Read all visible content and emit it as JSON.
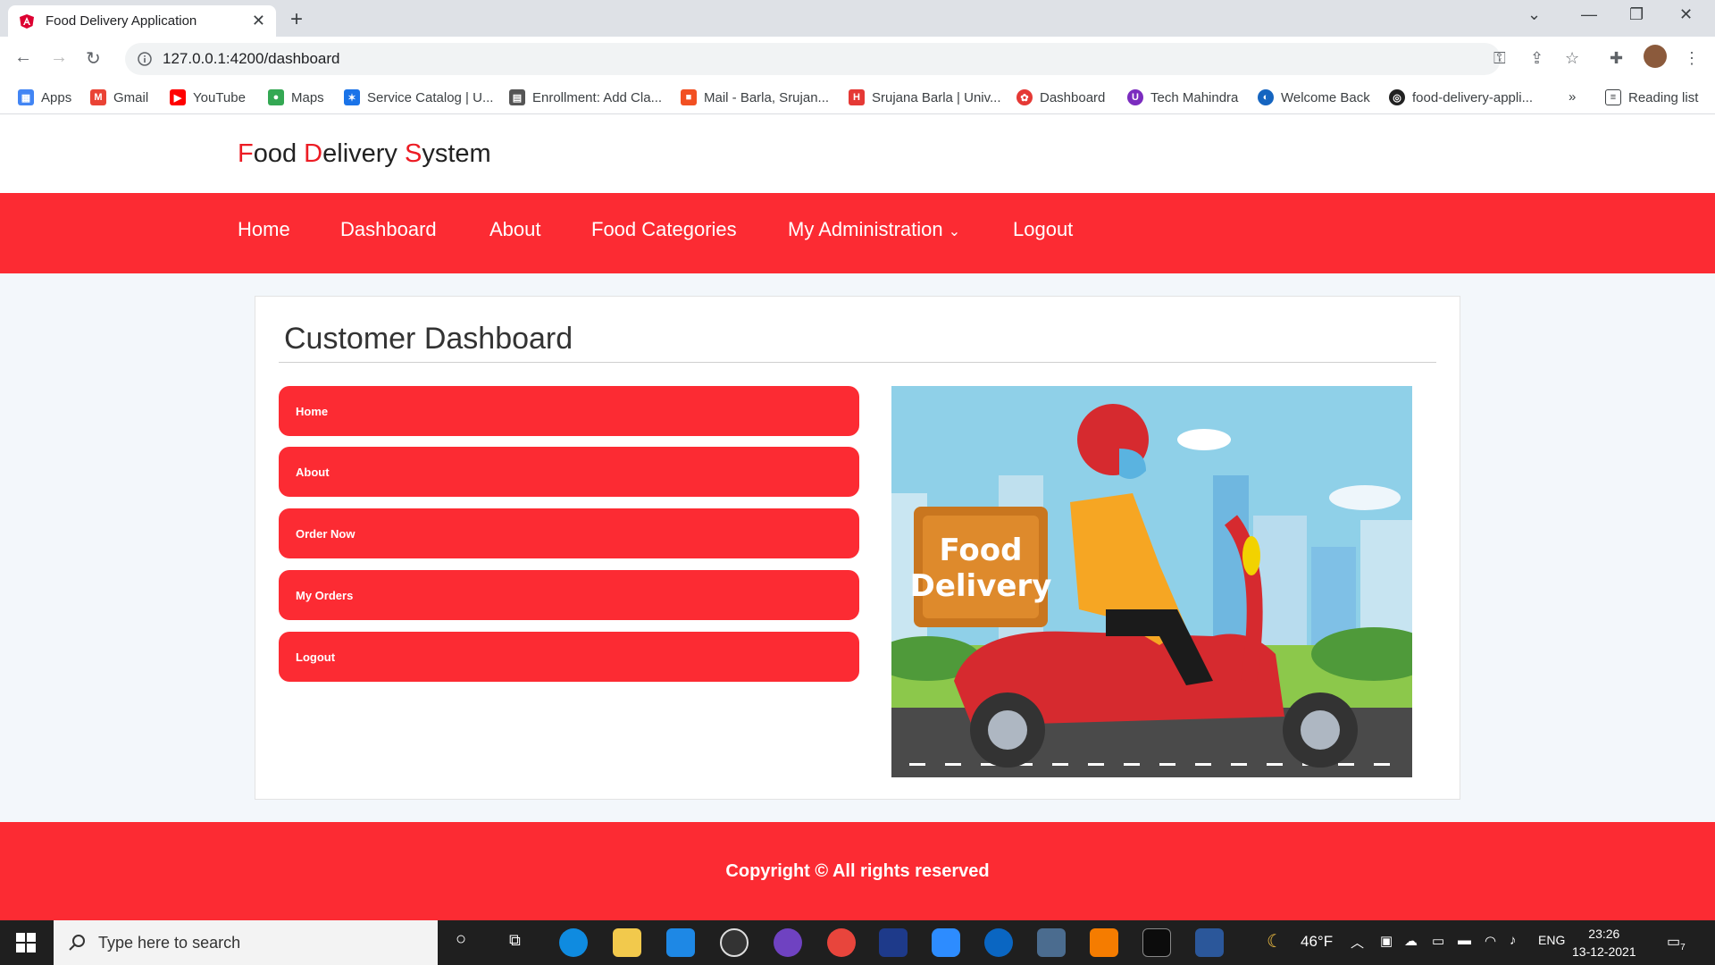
{
  "browser": {
    "tab_title": "Food Delivery Application",
    "tab_close": "✕",
    "new_tab": "+",
    "url": "127.0.0.1:4200/dashboard",
    "bookmarks": [
      {
        "label": "Apps",
        "color": "#4285f4"
      },
      {
        "label": "Gmail",
        "color": "#ea4335"
      },
      {
        "label": "YouTube",
        "color": "#ff0000"
      },
      {
        "label": "Maps",
        "color": "#34a853"
      },
      {
        "label": "Service Catalog | U...",
        "color": "#1a73e8"
      },
      {
        "label": "Enrollment: Add Cla...",
        "color": "#555555"
      },
      {
        "label": "Mail - Barla, Srujan...",
        "color": "#f25022"
      },
      {
        "label": "Srujana Barla | Univ...",
        "color": "#e53935"
      },
      {
        "label": "Dashboard",
        "color": "#e53935"
      },
      {
        "label": "Tech Mahindra",
        "color": "#7b2cbf"
      },
      {
        "label": "Welcome Back",
        "color": "#1565c0"
      },
      {
        "label": "food-delivery-appli...",
        "color": "#222222"
      }
    ],
    "more_bookmarks": "»",
    "reading_list": "Reading list"
  },
  "site": {
    "brand": {
      "f": "F",
      "ood": "ood ",
      "d": "D",
      "elivery": "elivery ",
      "s": "S",
      "ystem": "ystem"
    },
    "nav": [
      "Home",
      "Dashboard",
      "About",
      "Food Categories",
      "My Administration",
      "Logout"
    ],
    "nav_caret": "⌄",
    "dashboard": {
      "title": "Customer Dashboard",
      "buttons": [
        "Home",
        "About",
        "Order Now",
        "My Orders",
        "Logout"
      ],
      "hero_text": [
        "Food",
        "Delivery"
      ]
    },
    "footer": "Copyright © All rights reserved",
    "accent": "#fc2b33"
  },
  "taskbar": {
    "search_placeholder": "Type here to search",
    "weather": "46°F",
    "lang": "ENG",
    "time": "23:26",
    "date": "13-12-2021",
    "notifications": "7"
  }
}
